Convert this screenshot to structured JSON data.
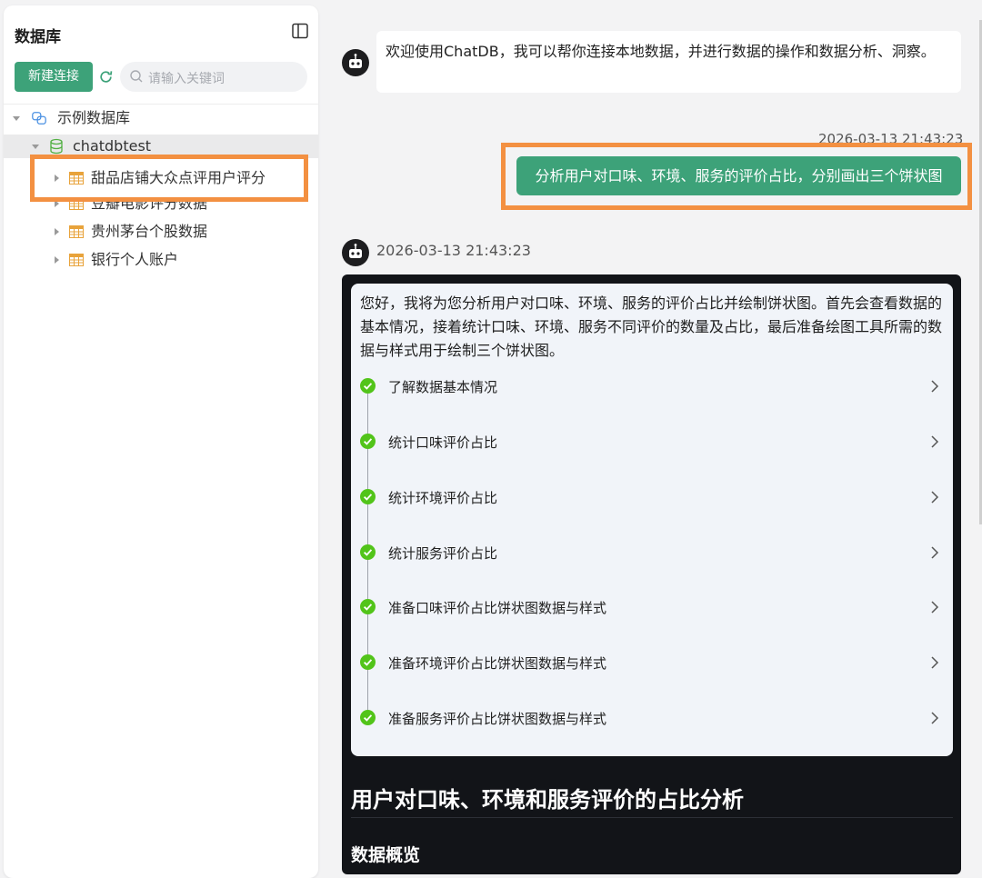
{
  "sidebar": {
    "title": "数据库",
    "new_connection_label": "新建连接",
    "search_placeholder": "请输入关键词",
    "tree": {
      "root_label": "示例数据库",
      "database_label": "chatdbtest",
      "tables": [
        {
          "label": "甜品店铺大众点评用户评分",
          "highlighted": true
        },
        {
          "label": "豆瓣电影评分数据",
          "highlighted": false
        },
        {
          "label": "贵州茅台个股数据",
          "highlighted": false
        },
        {
          "label": "银行个人账户",
          "highlighted": false
        }
      ]
    }
  },
  "chat": {
    "welcome_message": "欢迎使用ChatDB，我可以帮你连接本地数据，并进行数据的操作和数据分析、洞察。",
    "user_time": "2026-03-13 21:43:23",
    "user_message": "分析用户对口味、环境、服务的评价占比，分别画出三个饼状图",
    "bot_time": "2026-03-13 21:43:23",
    "plan_intro": "您好，我将为您分析用户对口味、环境、服务的评价占比并绘制饼状图。首先会查看数据的基本情况，接着统计口味、环境、服务不同评价的数量及占比，最后准备绘图工具所需的数据与样式用于绘制三个饼状图。",
    "steps": [
      {
        "label": "了解数据基本情况",
        "status": "done"
      },
      {
        "label": "统计口味评价占比",
        "status": "done"
      },
      {
        "label": "统计环境评价占比",
        "status": "done"
      },
      {
        "label": "统计服务评价占比",
        "status": "done"
      },
      {
        "label": "准备口味评价占比饼状图数据与样式",
        "status": "done"
      },
      {
        "label": "准备环境评价占比饼状图数据与样式",
        "status": "done"
      },
      {
        "label": "准备服务评价占比饼状图数据与样式",
        "status": "done"
      }
    ],
    "report_title": "用户对口味、环境和服务评价的占比分析",
    "report_subtitle": "数据概览"
  },
  "colors": {
    "accent": "#3da279",
    "highlight": "#f39041",
    "check": "#52c41a"
  },
  "icons": {
    "sidebar_toggle": "sidebar-toggle-icon",
    "refresh": "refresh-icon",
    "search": "search-icon",
    "root": "database-link-icon",
    "database": "database-icon",
    "table": "table-icon",
    "avatar": "robot-icon",
    "check": "check-circle-icon",
    "chevron": "chevron-right-icon"
  }
}
